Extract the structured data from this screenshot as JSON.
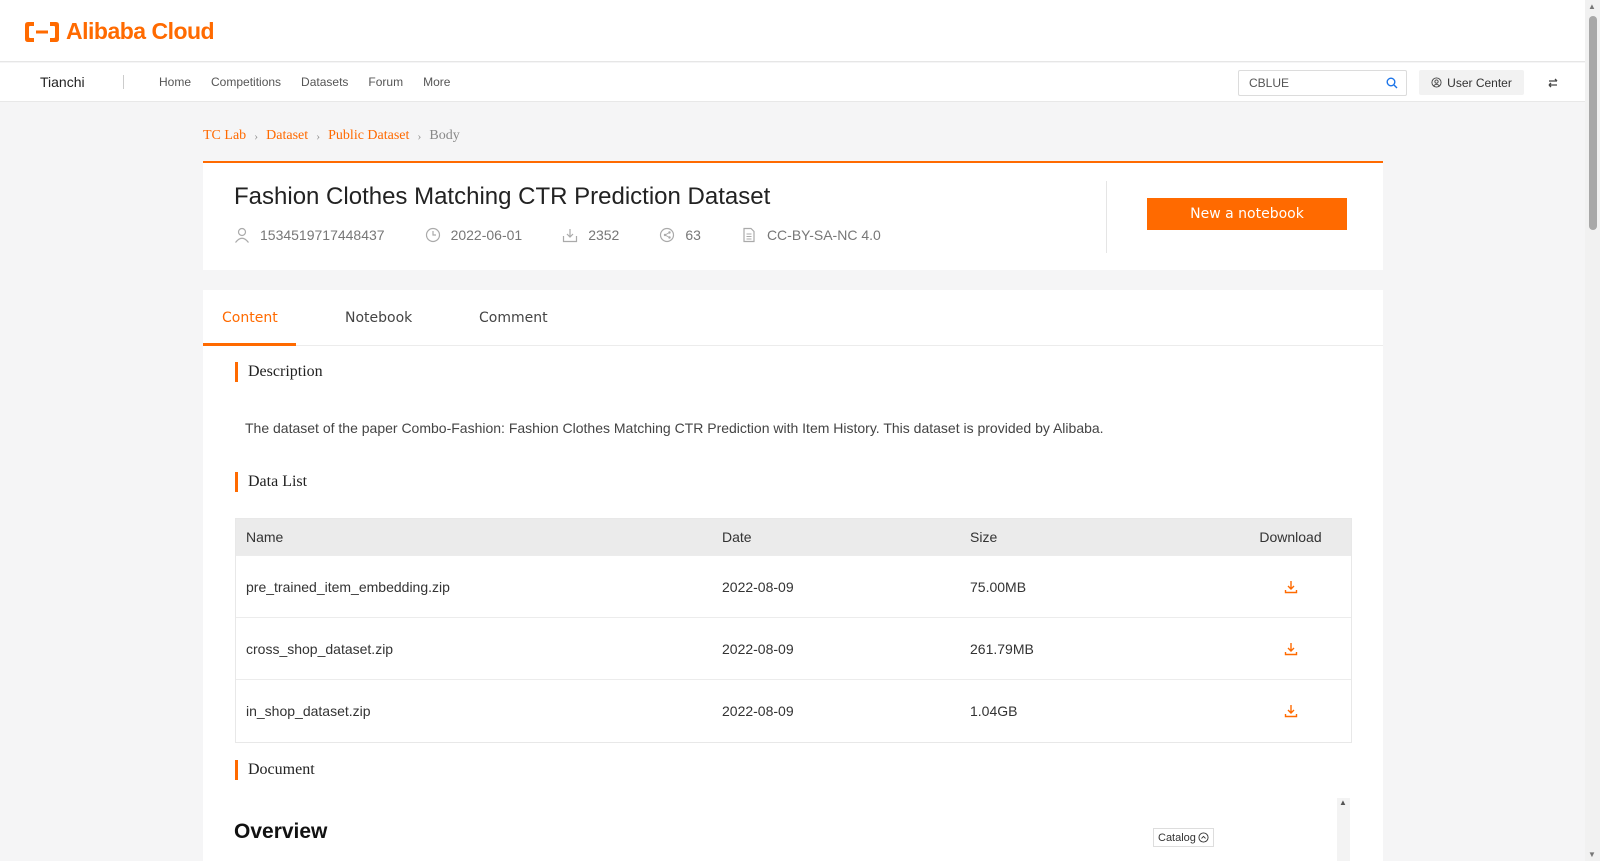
{
  "brand": {
    "logo_text": "Alibaba Cloud",
    "accent": "#ff6a00"
  },
  "nav": {
    "site": "Tianchi",
    "links": [
      "Home",
      "Competitions",
      "Datasets",
      "Forum",
      "More"
    ],
    "search_value": "CBLUE",
    "user_center": "User Center"
  },
  "breadcrumb": [
    "TC Lab",
    "Dataset",
    "Public Dataset",
    "Body"
  ],
  "dataset": {
    "title": "Fashion Clothes Matching CTR Prediction Dataset",
    "user_id": "1534519717448437",
    "date": "2022-06-01",
    "downloads": "2352",
    "shares": "63",
    "license": "CC-BY-SA-NC 4.0",
    "new_notebook": "New a notebook"
  },
  "tabs": [
    "Content",
    "Notebook",
    "Comment"
  ],
  "sections": {
    "description_title": "Description",
    "description_text": "The dataset of the paper Combo-Fashion: Fashion Clothes Matching CTR Prediction with Item History. This dataset is provided by Alibaba.",
    "datalist_title": "Data List",
    "document_title": "Document",
    "overview": "Overview",
    "catalog": "Catalog"
  },
  "table": {
    "headers": [
      "Name",
      "Date",
      "Size",
      "Download"
    ],
    "rows": [
      {
        "name": "pre_trained_item_embedding.zip",
        "date": "2022-08-09",
        "size": "75.00MB"
      },
      {
        "name": "cross_shop_dataset.zip",
        "date": "2022-08-09",
        "size": "261.79MB"
      },
      {
        "name": "in_shop_dataset.zip",
        "date": "2022-08-09",
        "size": "1.04GB"
      }
    ]
  }
}
